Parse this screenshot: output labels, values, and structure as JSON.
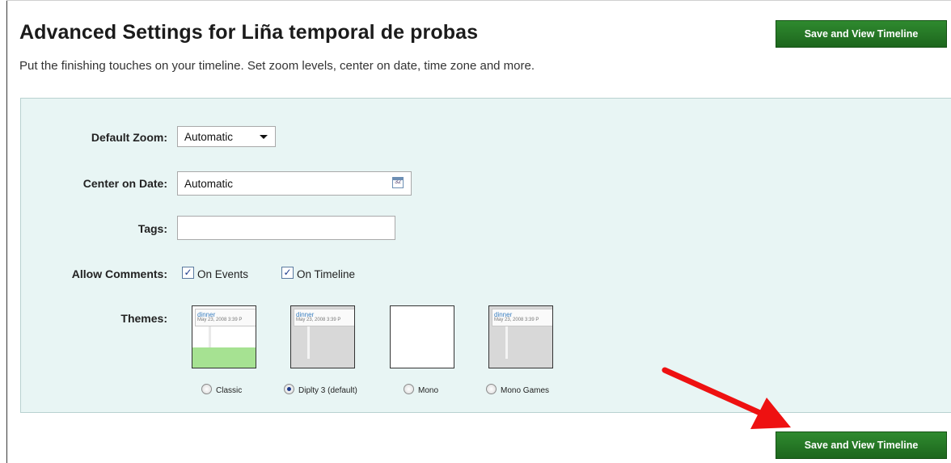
{
  "page": {
    "title": "Advanced Settings for Liña temporal de probas",
    "subtitle": "Put the finishing touches on your timeline. Set zoom levels, center on date, time zone and more.",
    "save_button_label": "Save and View Timeline",
    "accent_color": "#1d661d",
    "panel_color": "#e8f5f4",
    "annotation_arrow_color": "#ee1111"
  },
  "form": {
    "zoom": {
      "label": "Default Zoom:",
      "value": "Automatic"
    },
    "center_date": {
      "label": "Center on Date:",
      "value": "Automatic",
      "icon": "calendar-icon",
      "icon_text": "32"
    },
    "tags": {
      "label": "Tags:",
      "value": ""
    },
    "comments": {
      "label": "Allow Comments:",
      "on_events": {
        "label": "On Events",
        "checked": true
      },
      "on_timeline": {
        "label": "On Timeline",
        "checked": true
      }
    },
    "themes": {
      "label": "Themes:",
      "selected": "Diplty 3 (default)",
      "options": [
        {
          "label": "Classic",
          "preview_title": "dinner",
          "preview_date": "May 23, 2008 3:39 P",
          "checked": false
        },
        {
          "label": "Diplty 3 (default)",
          "preview_title": "dinner",
          "preview_date": "May 23, 2008 3:39 P",
          "checked": true
        },
        {
          "label": "Mono",
          "checked": false
        },
        {
          "label": "Mono Games",
          "preview_title": "dinner",
          "preview_date": "May 23, 2008 3:39 P",
          "checked": false
        }
      ]
    }
  }
}
